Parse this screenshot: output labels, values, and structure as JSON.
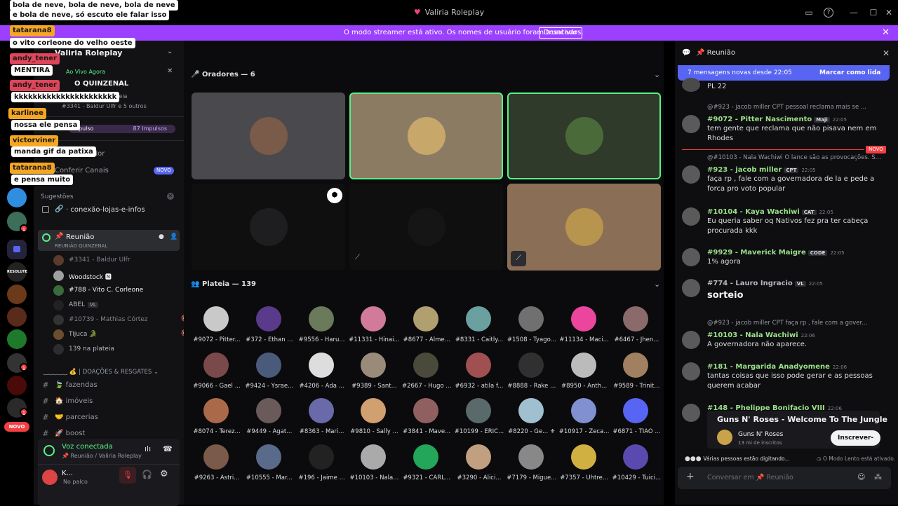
{
  "window": {
    "title": "Valiria Roleplay"
  },
  "banner": {
    "message": "O modo streamer está ativo. Os nomes de usuário foram truncados.",
    "button": "Desativar"
  },
  "server": {
    "name": "Valiria Roleplay",
    "event_live": "Ao Vivo Agora",
    "event_title": "O QUINZENAL",
    "event_sub": "plateia",
    "event_users": "#3341 - Baldur Ulfr e 5 outros",
    "boost_label": "impulso",
    "boost_count": "87 Impulsos",
    "rvidor": "rvidor",
    "check_channels": "Conferir Canais",
    "novo_badge": "NOVO",
    "suggestions": "Sugestões",
    "suggest_channel": "conexão-lojas-e-infos"
  },
  "voice_channel": {
    "name": "Reunião",
    "sub": "REUNIÃO QUINZENAL",
    "users": [
      {
        "name": "#3341 - Baldur Ulfr",
        "color": "#5a3b2e"
      },
      {
        "name": "Woodstock 🅽",
        "color": "#a0a0a0"
      },
      {
        "name": "#788 - Vito C. Corleone",
        "color": "#3a6b3a"
      },
      {
        "name": "ABEL",
        "tag": "VL",
        "color": "#222"
      },
      {
        "name": "#10739 - Mathias Córtez",
        "color": "#333"
      },
      {
        "name": "Tijuca 🐊",
        "color": "#6b4e2e"
      }
    ],
    "audience": "139 na plateia"
  },
  "category": {
    "name": "| DOAÇÕES & RESGATES"
  },
  "text_channels": [
    {
      "name": "fazendas",
      "emoji": "🍃"
    },
    {
      "name": "imóveis",
      "emoji": "🏠"
    },
    {
      "name": "parcerias",
      "emoji": "🤝"
    },
    {
      "name": "boost",
      "emoji": "🚀"
    }
  ],
  "voice_status": {
    "title": "Voz conectada",
    "sub": "Reunião / Valiria Roleplay"
  },
  "user_panel": {
    "name": "K...",
    "status": "No palco"
  },
  "stage": {
    "speakers_header": "Oradores — 6",
    "audience_header": "Plateia — 139",
    "speakers": [
      {
        "bg": "#4a4a4e",
        "av": "#7a5a48",
        "border": ""
      },
      {
        "bg": "#8c7b63",
        "av": "#c7a86a",
        "border": "#57f287"
      },
      {
        "bg": "#2f3a2a",
        "av": "#4a6a3a",
        "border": "#57f287"
      },
      {
        "bg": "#0f0f10",
        "av": "#1e1e20",
        "border": ""
      },
      {
        "bg": "#0f0f10",
        "av": "#151515",
        "border": ""
      },
      {
        "bg": "#8a6e55",
        "av": "#b8954e",
        "border": ""
      }
    ],
    "audience": [
      "#9072 - Pitter...",
      "#372 - Ethan ...",
      "#9556 - Haru...",
      "#11331 - Hinai...",
      "#8677 - Alme...",
      "#8331 - Caitly...",
      "#1508 - Tyago...",
      "#11134 - Maci...",
      "#6467 - Jhen...",
      "#9066 - Gael ...",
      "#9424 - Ysrae...",
      "#4206 - Ada ...",
      "#9389 - Sant...",
      "#2667 - Hugo ...",
      "#6932 - atila f...",
      "#8888 - Rake ...",
      "#8950 - Anth...",
      "#9589 - Trinit...",
      "#8074 - Terez...",
      "#9449 - Agat...",
      "#8363 - Mari...",
      "#9810 - Sally ...",
      "#3841 - Mave...",
      "#10199 - ERIC...",
      "#8220 - Ge... ⚜",
      "#10917 - Zeca...",
      "#6871 - TIAO ...",
      "#9263 - Astri...",
      "#10555 - Mar...",
      "#196 - Jaime ...",
      "#10103 - Nala...",
      "#9321 - CARL...",
      "#3290 - Alici...",
      "#7179 - Migue...",
      "#7357 - Uhtre...",
      "#10429 - Tuici..."
    ]
  },
  "chat": {
    "channel": "Reunião",
    "new_messages": "7 mensagens novas desde 22:05",
    "mark_read": "Marcar como lida",
    "new_label": "NOVO",
    "messages": [
      {
        "text": "PL 22"
      },
      {
        "reply": "@#923 - jacob  miller  CPT  pessoal reclama mais se ...",
        "name": "#9072 - Pitter Nascimento",
        "tag": "Maji",
        "time": "22:05",
        "text": "tem gente que reclama que não pisava nem em Rhodes",
        "color": "#9be08a"
      },
      {
        "reply": "@#10103 - Nala Wachiwi  O lance são as provocações. S...",
        "name": "#923 - jacob  miller",
        "tag": "CPT",
        "time": "22:05",
        "text": "faça rp , fale com a governadora de la e pede a forca pro voto popular",
        "color": "#9be08a"
      },
      {
        "name": "#10104 - Kaya Wachiwi",
        "tag": "CAT",
        "time": "22:05",
        "text": "Eu queria saber oq Nativos fez pra ter cabeça procurada kkk",
        "color": "#9be08a"
      },
      {
        "name": "#9929 - Maverick Maigre",
        "tag": "CODE",
        "time": "22:05",
        "text": "1% agora",
        "color": "#9be08a"
      },
      {
        "name": "#774 - Lauro  Ingracio",
        "tag": "VL",
        "time": "22:05",
        "text": "sorteio",
        "color": "#b5bac1"
      },
      {
        "reply": "@#923 - jacob  miller  CPT  faça rp , fale com a gover...",
        "name": "#10103 - Nala Wachiwi",
        "time": "22:06",
        "text": "A governadora não aparece.",
        "color": "#9be08a"
      },
      {
        "name": "#181 - Margarida Anadyomene",
        "time": "22:06",
        "text": "tantas coisas que isso pode gerar e as pessoas querem acabar",
        "color": "#9be08a"
      },
      {
        "name": "#148 - Phelippe Bonifacio VIII",
        "time": "22:06",
        "text": "",
        "color": "#9be08a"
      }
    ],
    "embed": {
      "title": "Guns N' Roses - Welcome To The Jungle",
      "channel": "Guns N' Roses",
      "subs": "13 mi de inscritos",
      "subscribe": "Inscrever-se"
    },
    "typing": "Várias pessoas estão digitando...",
    "slowmode": "O Modo Lento está ativado.",
    "input_placeholder": "Conversar em 📌 Reunião"
  },
  "overlay": [
    {
      "kind": "msg",
      "text": "bola de neve, bola de neve, bola de neve"
    },
    {
      "kind": "msg",
      "text": "e bola de neve, só escuto ele falar isso"
    },
    {
      "kind": "name",
      "text": "tatarana8"
    },
    {
      "kind": "msg",
      "text": "o vito corleone do velho oeste"
    },
    {
      "kind": "name",
      "text": "andy_tener"
    },
    {
      "kind": "msg",
      "text": "MENTIRA"
    },
    {
      "kind": "name",
      "text": "andy_tener"
    },
    {
      "kind": "msg",
      "text": "kkkkkkkkkkkkkkkkkkkkkk"
    },
    {
      "kind": "name",
      "text": "karlinee"
    },
    {
      "kind": "msg",
      "text": "nossa ele pensa"
    },
    {
      "kind": "name",
      "text": "victorviner"
    },
    {
      "kind": "msg",
      "text": "manda gif da patixa"
    },
    {
      "kind": "name",
      "text": "tatarana8"
    },
    {
      "kind": "msg",
      "text": "e pensa muito"
    }
  ]
}
